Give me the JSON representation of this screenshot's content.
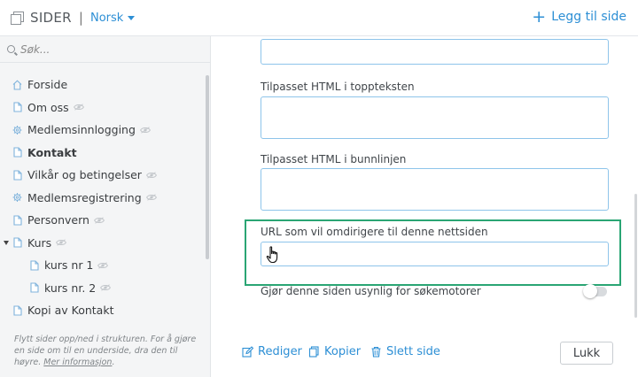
{
  "header": {
    "title": "SIDER",
    "separator": "|",
    "language": "Norsk",
    "add_page_label": "Legg til side",
    "add_page_icon": "+"
  },
  "sidebar": {
    "search_placeholder": "Søk...",
    "items": [
      {
        "label": "Forside",
        "icon": "home-icon"
      },
      {
        "label": "Om oss",
        "icon": "page-icon",
        "hidden": true
      },
      {
        "label": "Medlemsinnlogging",
        "icon": "gear-icon",
        "hidden": true
      },
      {
        "label": "Kontakt",
        "icon": "page-icon",
        "bold": true
      },
      {
        "label": "Vilkår og betingelser",
        "icon": "page-icon",
        "hidden": true
      },
      {
        "label": "Medlemsregistrering",
        "icon": "gear-icon",
        "hidden": true
      },
      {
        "label": "Personvern",
        "icon": "page-icon",
        "hidden": true
      },
      {
        "label": "Kurs",
        "icon": "page-icon",
        "hidden": true,
        "expanded": true
      },
      {
        "label": "kurs nr 1",
        "icon": "page-icon",
        "hidden": true,
        "child": true
      },
      {
        "label": "kurs nr. 2",
        "icon": "page-icon",
        "hidden": true,
        "child": true
      },
      {
        "label": "Kopi av Kontakt",
        "icon": "page-icon"
      }
    ],
    "help_text": "Flytt sider opp/ned i strukturen. For å gjøre en side om til en underside, dra den til høyre.",
    "help_link": "Mer informasjon",
    "help_end": "."
  },
  "form": {
    "header_html_label": "Tilpasset HTML i toppteksten",
    "footer_html_label": "Tilpasset HTML i bunnlinjen",
    "redirect_label": "URL som vil omdirigere til denne nettsiden",
    "redirect_value": "",
    "hide_search_label": "Gjør denne siden usynlig for søkemotorer",
    "hide_search_on": false
  },
  "actions": {
    "edit": "Rediger",
    "copy": "Kopier",
    "delete": "Slett side",
    "close": "Lukk"
  },
  "colors": {
    "accent": "#2d8fd5",
    "highlight": "#2aa574",
    "input_border": "#8ec4ea"
  }
}
